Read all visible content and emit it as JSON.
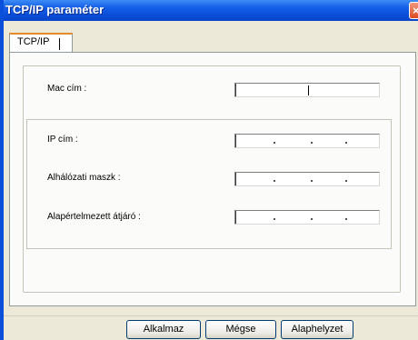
{
  "window": {
    "title": "TCP/IP paraméter",
    "close_symbol": "×"
  },
  "tabs": [
    {
      "label": "TCP/IP",
      "selected": true
    }
  ],
  "form": {
    "mac_label": "Mac cím :",
    "ip_label": "IP cím :",
    "subnet_label": "Alhálózati maszk :",
    "gateway_label": "Alapértelmezett átjáró :"
  },
  "buttons": {
    "apply": "Alkalmaz",
    "cancel": "Mégse",
    "reset": "Alaphelyzet"
  },
  "colors": {
    "titlebar": "#0a4fd9",
    "tab_highlight": "#e68b2c",
    "dialog_bg": "#ece9d8"
  }
}
